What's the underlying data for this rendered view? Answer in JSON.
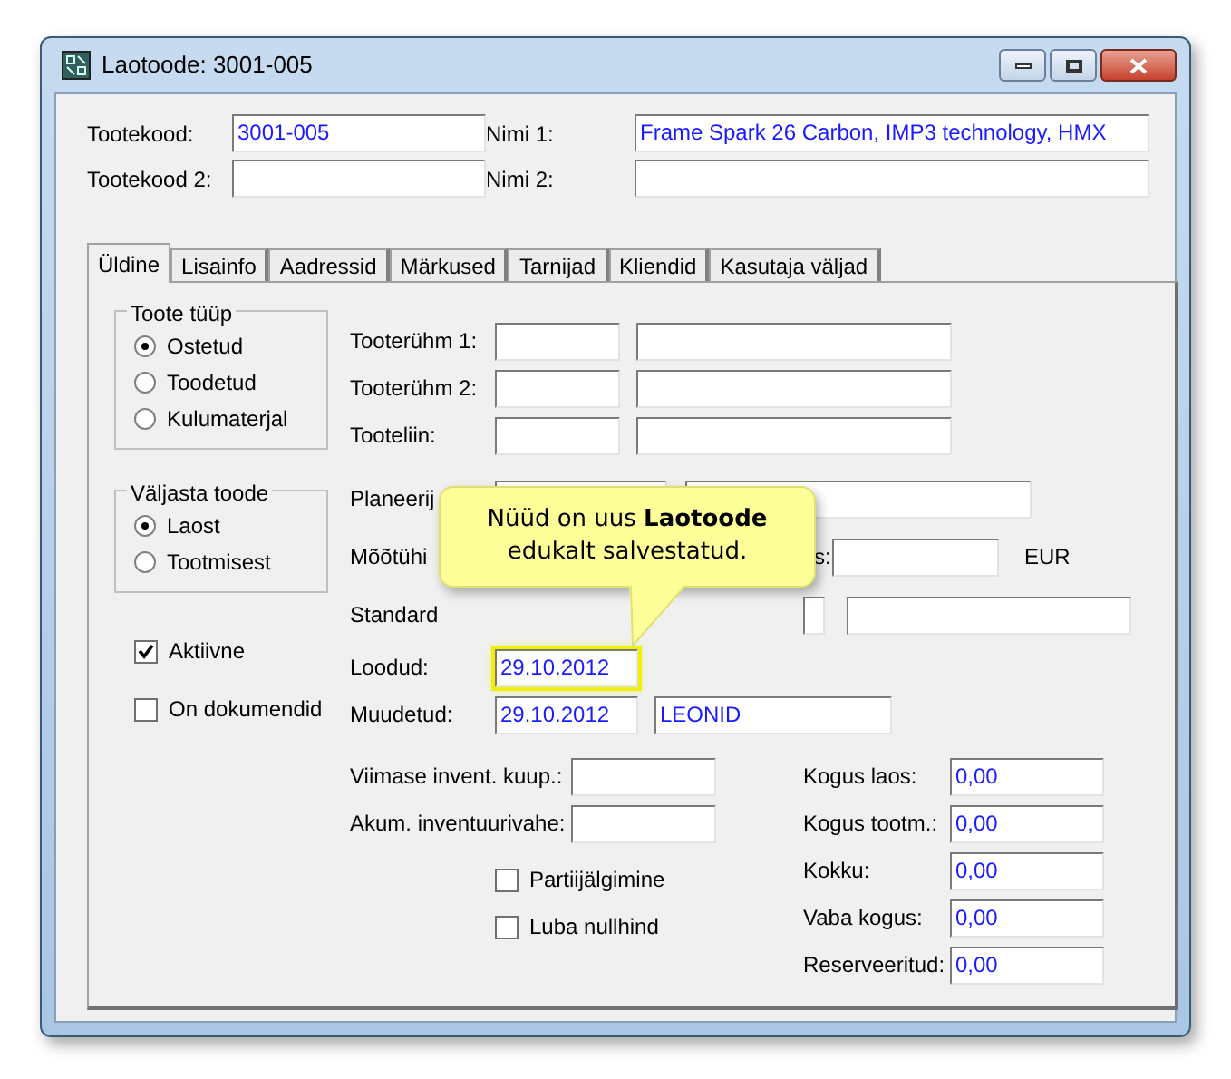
{
  "window": {
    "title": "Laotoode: 3001-005"
  },
  "header_fields": [
    {
      "label": "Tootekood:",
      "value": "3001-005"
    },
    {
      "label": "Nimi 1:",
      "value": "Frame Spark 26 Carbon, IMP3 technology, HMX"
    },
    {
      "label": "Tootekood 2:"
    },
    {
      "label": "Nimi 2:"
    }
  ],
  "tabs": [
    {
      "label": "Üldine",
      "selected": true
    },
    {
      "label": "Lisainfo",
      "selected": false
    },
    {
      "label": "Aadressid",
      "selected": false
    },
    {
      "label": "Märkused",
      "selected": false
    },
    {
      "label": "Tarnijad",
      "selected": false
    },
    {
      "label": "Kliendid",
      "selected": false
    },
    {
      "label": "Kasutaja väljad",
      "selected": false
    }
  ],
  "groups": [
    {
      "title": "Toote tüüp",
      "options": [
        {
          "label": "Ostetud",
          "selected": true
        },
        {
          "label": "Toodetud",
          "selected": false
        },
        {
          "label": "Kulumaterjal",
          "selected": false
        }
      ]
    },
    {
      "title": "Väljasta toode",
      "options": [
        {
          "label": "Laost",
          "selected": true
        },
        {
          "label": "Tootmisest",
          "selected": false
        }
      ]
    }
  ],
  "left_checks": [
    {
      "label": "Aktiivne",
      "checked": true
    },
    {
      "label": "On dokumendid",
      "checked": false
    }
  ],
  "group_fields": [
    {
      "label": "Tooterühm 1:"
    },
    {
      "label": "Tooterühm 2:"
    },
    {
      "label": "Tooteliin:"
    }
  ],
  "covered_labels": {
    "planner": "Planeerij",
    "unit": "Mõõtühi",
    "price_suffix": "s:",
    "currency": "EUR",
    "standard": "Standard"
  },
  "dates": [
    {
      "label": "Loodud:",
      "value": "29.10.2012",
      "highlighted": true
    },
    {
      "label": "Muudetud:",
      "value": "29.10.2012",
      "user": "LEONID",
      "highlighted": false
    }
  ],
  "inventory_fields": [
    {
      "label": "Viimase invent. kuup.:"
    },
    {
      "label": "Akum. inventuurivahe:"
    }
  ],
  "middle_checks": [
    {
      "label": "Partiijälgimine",
      "checked": false
    },
    {
      "label": "Luba nullhind",
      "checked": false
    }
  ],
  "quantities": [
    {
      "label": "Kogus laos:",
      "value": "0,00"
    },
    {
      "label": "Kogus tootm.:",
      "value": "0,00"
    },
    {
      "label": "Kokku:",
      "value": "0,00"
    },
    {
      "label": "Vaba kogus:",
      "value": "0,00"
    },
    {
      "label": "Reserveeritud:",
      "value": "0,00"
    }
  ],
  "callout": {
    "text": "Nüüd on uus **Laotoode** edukalt salvestatud."
  }
}
